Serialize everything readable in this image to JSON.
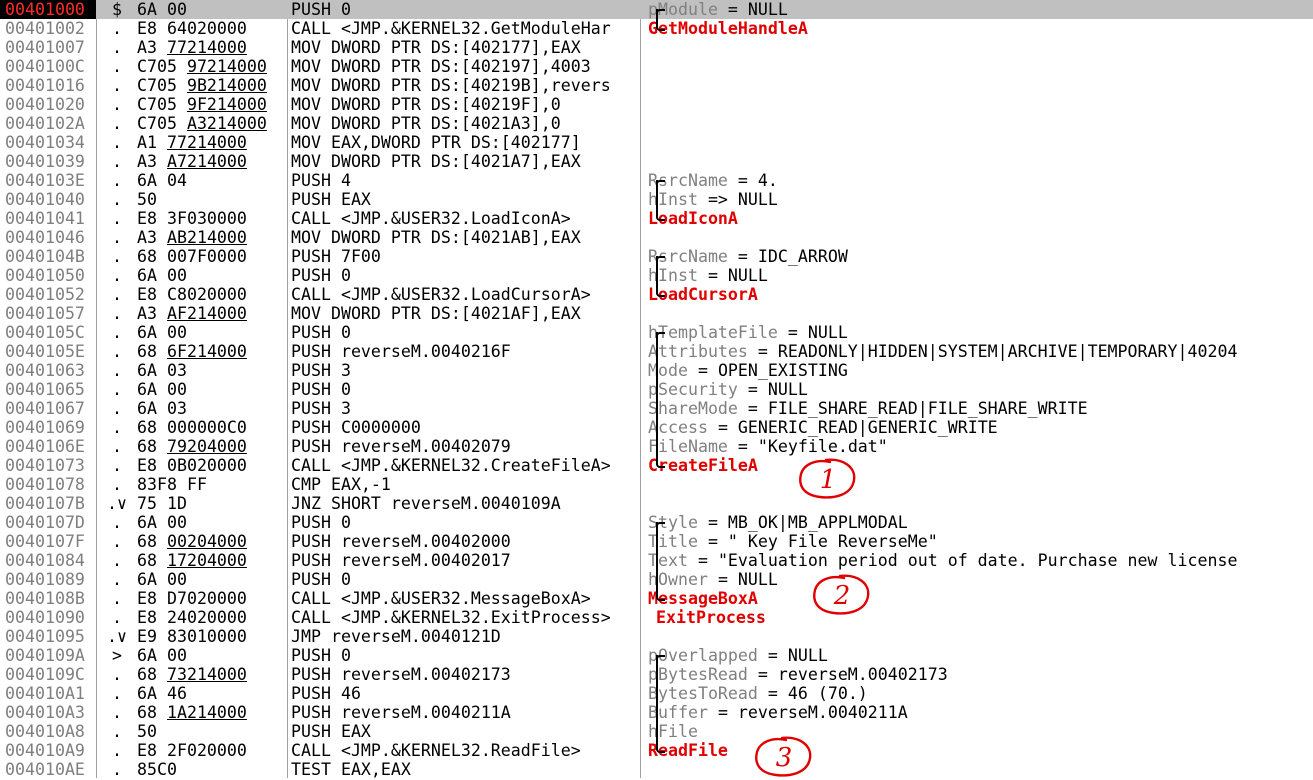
{
  "listing": {
    "rows": [
      {
        "addr": "00401000",
        "mark": "$",
        "hex": "6A 00",
        "dis": "PUSH 0",
        "cp": "pModule",
        "cv": " = NULL",
        "sel": true
      },
      {
        "addr": "00401002",
        "mark": ".",
        "hex": "E8 64020000",
        "dis": "CALL <JMP.&KERNEL32.GetModuleHar",
        "api": "GetModuleHandleA"
      },
      {
        "addr": "00401007",
        "mark": ".",
        "hex": "A3 77214000",
        "dis": "MOV DWORD PTR DS:[402177],EAX",
        "hu": true
      },
      {
        "addr": "0040100C",
        "mark": ".",
        "hex": "C705 97214000",
        "dis": "MOV DWORD PTR DS:[402197],4003",
        "hu": true
      },
      {
        "addr": "00401016",
        "mark": ".",
        "hex": "C705 9B214000",
        "dis": "MOV DWORD PTR DS:[40219B],revers",
        "hu": true
      },
      {
        "addr": "00401020",
        "mark": ".",
        "hex": "C705 9F214000",
        "dis": "MOV DWORD PTR DS:[40219F],0",
        "hu": true
      },
      {
        "addr": "0040102A",
        "mark": ".",
        "hex": "C705 A3214000",
        "dis": "MOV DWORD PTR DS:[4021A3],0",
        "hu": true
      },
      {
        "addr": "00401034",
        "mark": ".",
        "hex": "A1 77214000",
        "dis": "MOV EAX,DWORD PTR DS:[402177]",
        "hu": true
      },
      {
        "addr": "00401039",
        "mark": ".",
        "hex": "A3 A7214000",
        "dis": "MOV DWORD PTR DS:[4021A7],EAX",
        "hu": true
      },
      {
        "addr": "0040103E",
        "mark": ".",
        "hex": "6A 04",
        "dis": "PUSH 4",
        "cp": "RsrcName",
        "cv": " = 4."
      },
      {
        "addr": "00401040",
        "mark": ".",
        "hex": "50",
        "dis": "PUSH EAX",
        "cp": "hInst",
        "cv": " => NULL"
      },
      {
        "addr": "00401041",
        "mark": ".",
        "hex": "E8 3F030000",
        "dis": "CALL <JMP.&USER32.LoadIconA>",
        "api": "LoadIconA"
      },
      {
        "addr": "00401046",
        "mark": ".",
        "hex": "A3 AB214000",
        "dis": "MOV DWORD PTR DS:[4021AB],EAX",
        "hu": true
      },
      {
        "addr": "0040104B",
        "mark": ".",
        "hex": "68 007F0000",
        "dis": "PUSH 7F00",
        "cp": "RsrcName",
        "cv": " = IDC_ARROW"
      },
      {
        "addr": "00401050",
        "mark": ".",
        "hex": "6A 00",
        "dis": "PUSH 0",
        "cp": "hInst",
        "cv": " = NULL"
      },
      {
        "addr": "00401052",
        "mark": ".",
        "hex": "E8 C8020000",
        "dis": "CALL <JMP.&USER32.LoadCursorA>",
        "api": "LoadCursorA"
      },
      {
        "addr": "00401057",
        "mark": ".",
        "hex": "A3 AF214000",
        "dis": "MOV DWORD PTR DS:[4021AF],EAX",
        "hu": true
      },
      {
        "addr": "0040105C",
        "mark": ".",
        "hex": "6A 00",
        "dis": "PUSH 0",
        "cp": "hTemplateFile",
        "cv": " = NULL"
      },
      {
        "addr": "0040105E",
        "mark": ".",
        "hex": "68 6F214000",
        "dis": "PUSH reverseM.0040216F",
        "hu": true,
        "cp": "Attributes",
        "cv": " = READONLY|HIDDEN|SYSTEM|ARCHIVE|TEMPORARY|40204"
      },
      {
        "addr": "00401063",
        "mark": ".",
        "hex": "6A 03",
        "dis": "PUSH 3",
        "cp": "Mode",
        "cv": " = OPEN_EXISTING"
      },
      {
        "addr": "00401065",
        "mark": ".",
        "hex": "6A 00",
        "dis": "PUSH 0",
        "cp": "pSecurity",
        "cv": " = NULL"
      },
      {
        "addr": "00401067",
        "mark": ".",
        "hex": "6A 03",
        "dis": "PUSH 3",
        "cp": "ShareMode",
        "cv": " = FILE_SHARE_READ|FILE_SHARE_WRITE"
      },
      {
        "addr": "00401069",
        "mark": ".",
        "hex": "68 000000C0",
        "dis": "PUSH C0000000",
        "cp": "Access",
        "cv": " = GENERIC_READ|GENERIC_WRITE"
      },
      {
        "addr": "0040106E",
        "mark": ".",
        "hex": "68 79204000",
        "dis": "PUSH reverseM.00402079",
        "hu": true,
        "cp": "FileName",
        "cv": " = \"Keyfile.dat\""
      },
      {
        "addr": "00401073",
        "mark": ".",
        "hex": "E8 0B020000",
        "dis": "CALL <JMP.&KERNEL32.CreateFileA>",
        "api": "CreateFileA"
      },
      {
        "addr": "00401078",
        "mark": ".",
        "hex": "83F8 FF",
        "dis": "CMP EAX,-1"
      },
      {
        "addr": "0040107B",
        "mark": ".∨",
        "hex": "75 1D",
        "dis": "JNZ SHORT reverseM.0040109A"
      },
      {
        "addr": "0040107D",
        "mark": ".",
        "hex": "6A 00",
        "dis": "PUSH 0",
        "cp": "Style",
        "cv": " = MB_OK|MB_APPLMODAL"
      },
      {
        "addr": "0040107F",
        "mark": ".",
        "hex": "68 00204000",
        "dis": "PUSH reverseM.00402000",
        "hu": true,
        "cp": "Title",
        "cv": " = \" Key File ReverseMe\""
      },
      {
        "addr": "00401084",
        "mark": ".",
        "hex": "68 17204000",
        "dis": "PUSH reverseM.00402017",
        "hu": true,
        "cp": "Text",
        "cv": " = \"Evaluation period out of date. Purchase new license"
      },
      {
        "addr": "00401089",
        "mark": ".",
        "hex": "6A 00",
        "dis": "PUSH 0",
        "cp": "hOwner",
        "cv": " = NULL"
      },
      {
        "addr": "0040108B",
        "mark": ".",
        "hex": "E8 D7020000",
        "dis": "CALL <JMP.&USER32.MessageBoxA>",
        "api": "MessageBoxA"
      },
      {
        "addr": "00401090",
        "mark": ".",
        "hex": "E8 24020000",
        "dis": "CALL <JMP.&KERNEL32.ExitProcess>",
        "api": "ExitProcess"
      },
      {
        "addr": "00401095",
        "mark": ".∨",
        "hex": "E9 83010000",
        "dis": "JMP reverseM.0040121D"
      },
      {
        "addr": "0040109A",
        "mark": ">",
        "hex": "6A 00",
        "dis": "PUSH 0",
        "cp": "pOverlapped",
        "cv": " = NULL"
      },
      {
        "addr": "0040109C",
        "mark": ".",
        "hex": "68 73214000",
        "dis": "PUSH reverseM.00402173",
        "hu": true,
        "cp": "pBytesRead",
        "cv": " = reverseM.00402173"
      },
      {
        "addr": "004010A1",
        "mark": ".",
        "hex": "6A 46",
        "dis": "PUSH 46",
        "cp": "BytesToRead",
        "cv": " = 46 (70.)"
      },
      {
        "addr": "004010A3",
        "mark": ".",
        "hex": "68 1A214000",
        "dis": "PUSH reverseM.0040211A",
        "hu": true,
        "cp": "Buffer",
        "cv": " = reverseM.0040211A"
      },
      {
        "addr": "004010A8",
        "mark": ".",
        "hex": "50",
        "dis": "PUSH EAX",
        "cp": "hFile",
        "cv": ""
      },
      {
        "addr": "004010A9",
        "mark": ".",
        "hex": "E8 2F020000",
        "dis": "CALL <JMP.&KERNEL32.ReadFile>",
        "api": "ReadFile"
      },
      {
        "addr": "004010AE",
        "mark": ".",
        "hex": "85C0",
        "dis": "TEST EAX,EAX"
      }
    ],
    "annotations": [
      "1",
      "2",
      "3"
    ]
  },
  "colors": {
    "api": "#e00000",
    "param": "#808080",
    "address": "#7f7f7f",
    "selection_bar": "#c0c0c0",
    "selected_address_bg": "#000000",
    "selected_address_text": "#ff2a2a",
    "annotation": "#e00000"
  }
}
